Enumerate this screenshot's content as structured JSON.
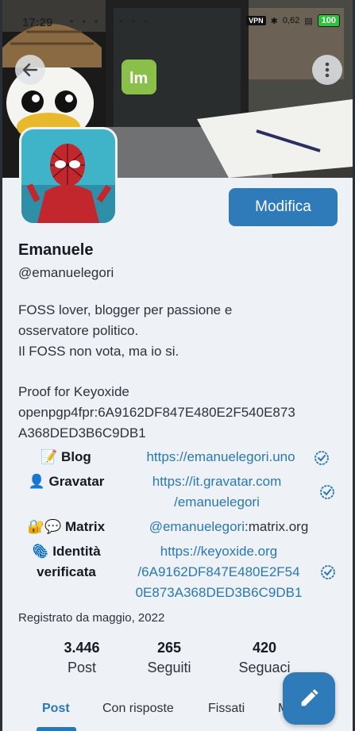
{
  "status_bar": {
    "time": "17:29",
    "notification_icons": "• • • • • • •",
    "vpn": "VPN",
    "network_speed": "0,62",
    "battery": "100"
  },
  "profile": {
    "display_name": "Emanuele",
    "handle": "@emanuelegori",
    "edit_label": "Modifica",
    "bio_lines": [
      "FOSS lover, blogger per passione e",
      "osservatore politico.",
      "Il FOSS non vota, ma io si.",
      "",
      "Proof for Keyoxide",
      "openpgp4fpr:6A9162DF847E480E2F540E873",
      "A368DED3B6C9DB1"
    ],
    "fields": [
      {
        "label_lines": [
          "📝 Blog"
        ],
        "value_lines": [
          "https://emanuelegori.uno"
        ],
        "plain_suffix": ""
      },
      {
        "label_lines": [
          "👤 Gravatar"
        ],
        "value_lines": [
          "https://it.gravatar.com",
          "/emanuelegori"
        ],
        "plain_suffix": ""
      },
      {
        "label_lines": [
          "🔐💬 Matrix"
        ],
        "value_lines": [
          "@emanuelegori"
        ],
        "plain_suffix": ":matrix.org"
      },
      {
        "label_lines": [
          "🫆 Identità",
          "verificata"
        ],
        "value_lines": [
          "https://keyoxide.org",
          "/6A9162DF847E480E2F54",
          "0E873A368DED3B6C9DB1"
        ],
        "plain_suffix": ""
      }
    ],
    "joined": "Registrato da maggio, 2022",
    "stats": [
      {
        "count": "3.446",
        "label": "Post"
      },
      {
        "count": "265",
        "label": "Seguiti"
      },
      {
        "count": "420",
        "label": "Seguaci"
      }
    ]
  },
  "tabs": [
    {
      "label": "Post",
      "active": true
    },
    {
      "label": "Con risposte",
      "active": false
    },
    {
      "label": "Fissati",
      "active": false
    },
    {
      "label": "M",
      "active": false
    }
  ],
  "colors": {
    "accent": "#2f7ab8",
    "link": "#2a78b3",
    "background": "#eef1f6"
  },
  "icons": {
    "back": "arrow-left-icon",
    "more": "more-vertical-icon",
    "verified": "verified-check-icon",
    "compose": "pencil-icon"
  }
}
